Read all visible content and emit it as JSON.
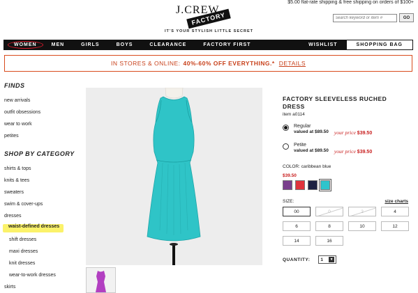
{
  "top_bar": {
    "shipping_text": "$5.00 flat-rate shipping & free shipping on orders of $100+",
    "search_placeholder": "search keyword or item #",
    "go_label": "GO"
  },
  "brand": {
    "logo_top": "J.CREW",
    "logo_bottom": "FACTORY",
    "tagline": "IT'S YOUR STYLISH LITTLE SECRET"
  },
  "nav": {
    "items": [
      "WOMEN",
      "MEN",
      "GIRLS",
      "BOYS",
      "CLEARANCE",
      "FACTORY FIRST"
    ],
    "wishlist": "WISHLIST",
    "shopping_bag": "SHOPPING BAG"
  },
  "promo": {
    "lead": "IN STORES & ONLINE:",
    "offer": "40%-60% OFF EVERYTHING.*",
    "details": "DETAILS"
  },
  "sidebar": {
    "finds_heading": "FINDS",
    "finds": [
      "new arrivals",
      "outfit obsessions",
      "wear to work",
      "petites"
    ],
    "category_heading": "SHOP BY CATEGORY",
    "categories": [
      "shirts & tops",
      "knits & tees",
      "sweaters",
      "swim & cover-ups",
      "dresses"
    ],
    "active_sub": "waist-defined dresses",
    "dress_subs": [
      "shift dresses",
      "maxi dresses",
      "knit dresses",
      "wear-to-work dresses"
    ],
    "after": [
      "skirts"
    ]
  },
  "product": {
    "title": "FACTORY SLEEVELESS RUCHED DRESS",
    "item_number": "item a0114",
    "options": [
      {
        "name": "Regular",
        "valued": "valued at $89.50",
        "your_price_label": "your price",
        "your_price": "$39.50",
        "selected": true
      },
      {
        "name": "Petite",
        "valued": "valued at $89.50",
        "your_price_label": "your price",
        "your_price": "$39.50",
        "selected": false
      }
    ],
    "color_label": "COLOR: caribbean blue",
    "color_price": "$39.50",
    "swatches": [
      "#7a3f8c",
      "#e0333c",
      "#1c2142",
      "#2fc4cc"
    ],
    "dress_color": "#2fc4c7",
    "thumb_color": "#b23fc1",
    "size_label": "SIZE:",
    "size_charts": "size charts",
    "sizes": [
      {
        "label": "00",
        "state": "selected"
      },
      {
        "label": "0",
        "state": "unavailable"
      },
      {
        "label": "2",
        "state": "unavailable"
      },
      {
        "label": "4",
        "state": "available"
      },
      {
        "label": "6",
        "state": "available"
      },
      {
        "label": "8",
        "state": "available"
      },
      {
        "label": "10",
        "state": "available"
      },
      {
        "label": "12",
        "state": "available"
      },
      {
        "label": "14",
        "state": "available"
      },
      {
        "label": "16",
        "state": "available"
      }
    ],
    "quantity_label": "QUANTITY:",
    "quantity_value": "1"
  }
}
